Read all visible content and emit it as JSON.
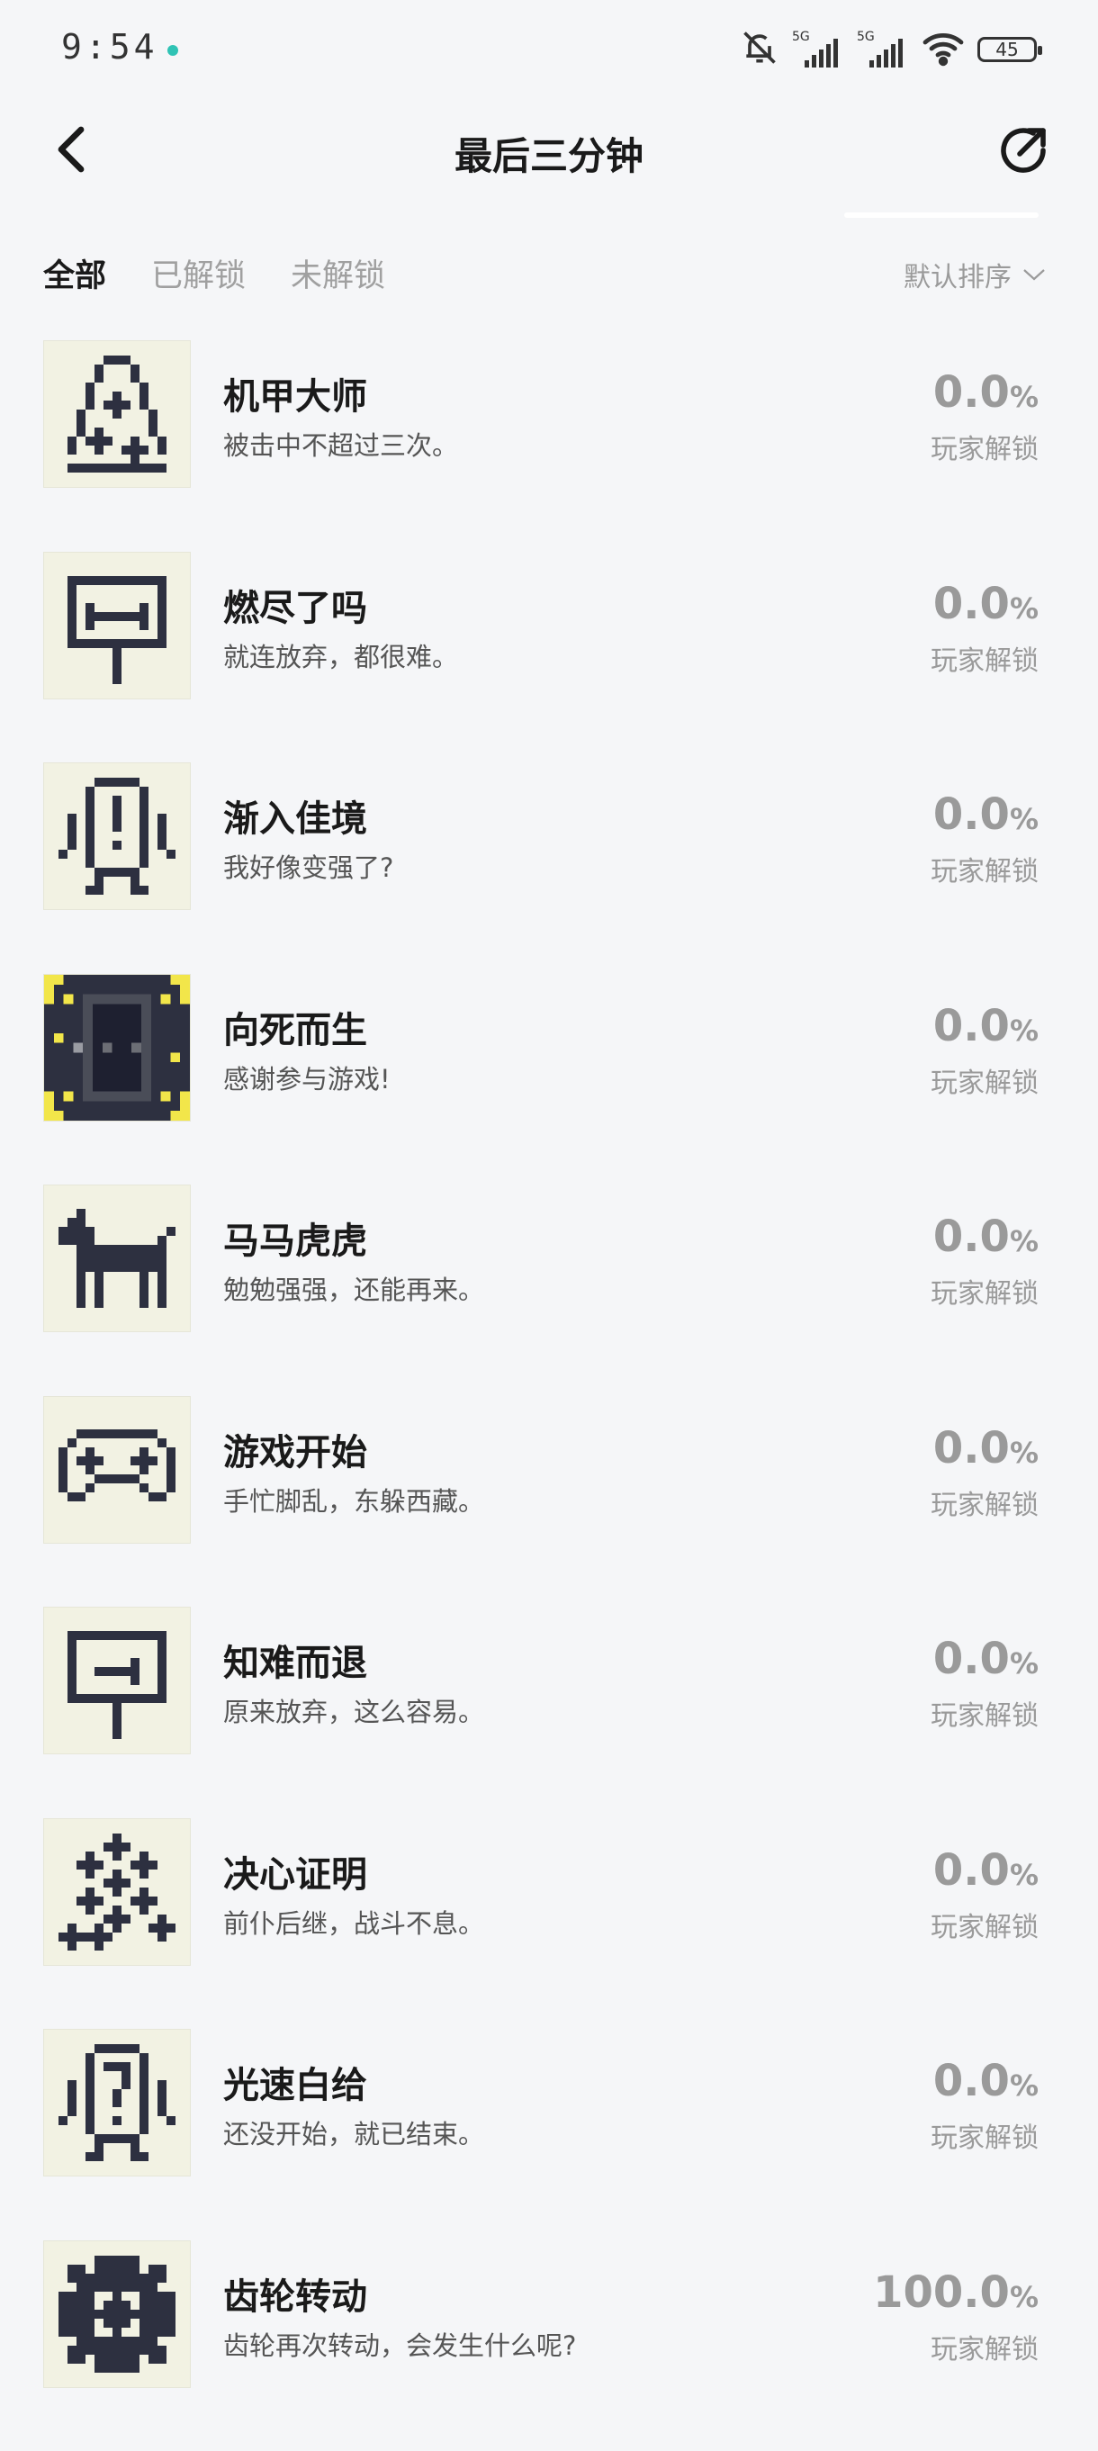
{
  "status_bar": {
    "time": "9:54",
    "battery": "45",
    "network_1": "5G",
    "network_2": "5G"
  },
  "header": {
    "title": "最后三分钟"
  },
  "tabs": [
    {
      "label": "全部",
      "active": true
    },
    {
      "label": "已解锁",
      "active": false
    },
    {
      "label": "未解锁",
      "active": false
    }
  ],
  "sort": {
    "label": "默认排序"
  },
  "achievements": [
    {
      "name": "机甲大师",
      "desc": "被击中不超过三次。",
      "percent": "0.0",
      "unit": "%",
      "label": "玩家解锁",
      "icon": "mech-triangle-icon"
    },
    {
      "name": "燃尽了吗",
      "desc": "就连放弃，都很难。",
      "percent": "0.0",
      "unit": "%",
      "label": "玩家解锁",
      "icon": "signpost-dumbbell-icon"
    },
    {
      "name": "渐入佳境",
      "desc": "我好像变强了?",
      "percent": "0.0",
      "unit": "%",
      "label": "玩家解锁",
      "icon": "robot-exclamation-icon"
    },
    {
      "name": "向死而生",
      "desc": "感谢参与游戏!",
      "percent": "0.0",
      "unit": "%",
      "label": "玩家解锁",
      "icon": "dark-door-yellow-icon"
    },
    {
      "name": "马马虎虎",
      "desc": "勉勉强强，还能再来。",
      "percent": "0.0",
      "unit": "%",
      "label": "玩家解锁",
      "icon": "horse-icon"
    },
    {
      "name": "游戏开始",
      "desc": "手忙脚乱，东躲西藏。",
      "percent": "0.0",
      "unit": "%",
      "label": "玩家解锁",
      "icon": "gamepad-icon"
    },
    {
      "name": "知难而退",
      "desc": "原来放弃，这么容易。",
      "percent": "0.0",
      "unit": "%",
      "label": "玩家解锁",
      "icon": "signpost-arrow-icon"
    },
    {
      "name": "决心证明",
      "desc": "前仆后继，战斗不息。",
      "percent": "0.0",
      "unit": "%",
      "label": "玩家解锁",
      "icon": "crosses-cluster-icon"
    },
    {
      "name": "光速白给",
      "desc": "还没开始，就已结束。",
      "percent": "0.0",
      "unit": "%",
      "label": "玩家解锁",
      "icon": "robot-question-icon"
    },
    {
      "name": "齿轮转动",
      "desc": "齿轮再次转动，会发生什么呢?",
      "percent": "100.0",
      "unit": "%",
      "label": "玩家解锁",
      "icon": "gear-icon"
    }
  ]
}
